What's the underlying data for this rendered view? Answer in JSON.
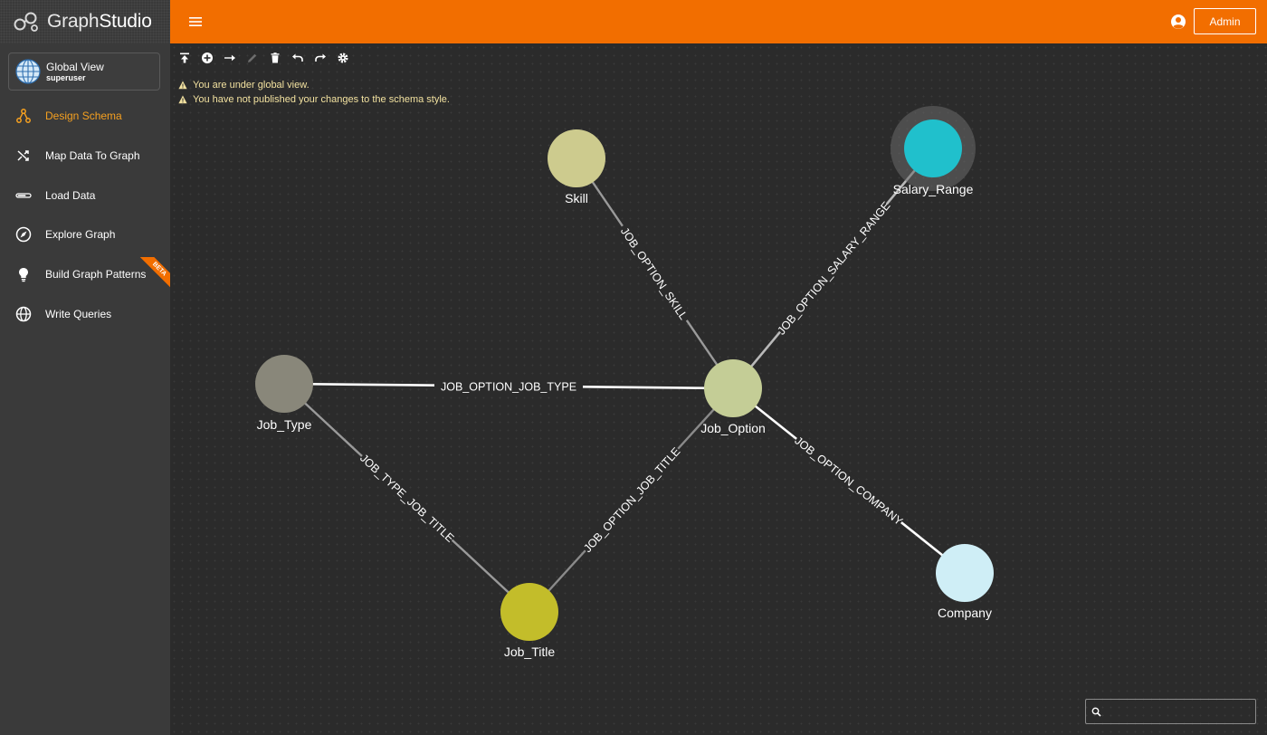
{
  "brand": {
    "name_part1": "Graph",
    "name_part2": "Studio"
  },
  "header": {
    "admin_label": "Admin",
    "menu_icon": "hamburger-icon",
    "user_icon": "account-circle-icon"
  },
  "colors": {
    "header": "#f26e00",
    "sidebar": "#3a3a3a",
    "canvas": "#2b2b2b",
    "active_nav": "#f5a020"
  },
  "view": {
    "title": "Global View",
    "user": "superuser"
  },
  "sidebar": {
    "items": [
      {
        "label": "Design Schema",
        "icon": "schema-icon",
        "active": true
      },
      {
        "label": "Map Data To Graph",
        "icon": "shuffle-icon",
        "active": false
      },
      {
        "label": "Load Data",
        "icon": "load-bar-icon",
        "active": false
      },
      {
        "label": "Explore Graph",
        "icon": "compass-icon",
        "active": false
      },
      {
        "label": "Build Graph Patterns",
        "icon": "lightbulb-icon",
        "active": false,
        "badge": "BETA"
      },
      {
        "label": "Write Queries",
        "icon": "globe-query-icon",
        "active": false
      }
    ]
  },
  "toolbar": {
    "tools": [
      "publish-icon",
      "add-vertex-icon",
      "add-edge-icon",
      "edit-icon",
      "delete-icon",
      "undo-icon",
      "redo-icon",
      "settings-icon"
    ]
  },
  "warnings": [
    "You are under global view.",
    "You have not published your changes to the schema style."
  ],
  "graph": {
    "nodes": [
      {
        "id": "Skill",
        "label": "Skill",
        "color": "#cdcb8e"
      },
      {
        "id": "Salary_Range",
        "label": "Salary_Range",
        "color": "#20c0cc",
        "selected": true
      },
      {
        "id": "Job_Type",
        "label": "Job_Type",
        "color": "#89877a"
      },
      {
        "id": "Job_Option",
        "label": "Job_Option",
        "color": "#c4cd96"
      },
      {
        "id": "Job_Title",
        "label": "Job_Title",
        "color": "#c3bd2a"
      },
      {
        "id": "Company",
        "label": "Company",
        "color": "#cfeef6"
      }
    ],
    "edges": [
      {
        "label": "JOB_OPTION_SKILL",
        "source": "Skill",
        "target": "Job_Option"
      },
      {
        "label": "JOB_OPTION_SALARY_RANGE",
        "source": "Salary_Range",
        "target": "Job_Option"
      },
      {
        "label": "JOB_OPTION_JOB_TYPE",
        "source": "Job_Type",
        "target": "Job_Option"
      },
      {
        "label": "JOB_TYPE_JOB_TITLE",
        "source": "Job_Type",
        "target": "Job_Title"
      },
      {
        "label": "JOB_OPTION_JOB_TITLE",
        "source": "Job_Title",
        "target": "Job_Option"
      },
      {
        "label": "JOB_OPTION_COMPANY",
        "source": "Job_Option",
        "target": "Company"
      }
    ]
  },
  "search": {
    "placeholder": "",
    "icon": "search-icon"
  }
}
